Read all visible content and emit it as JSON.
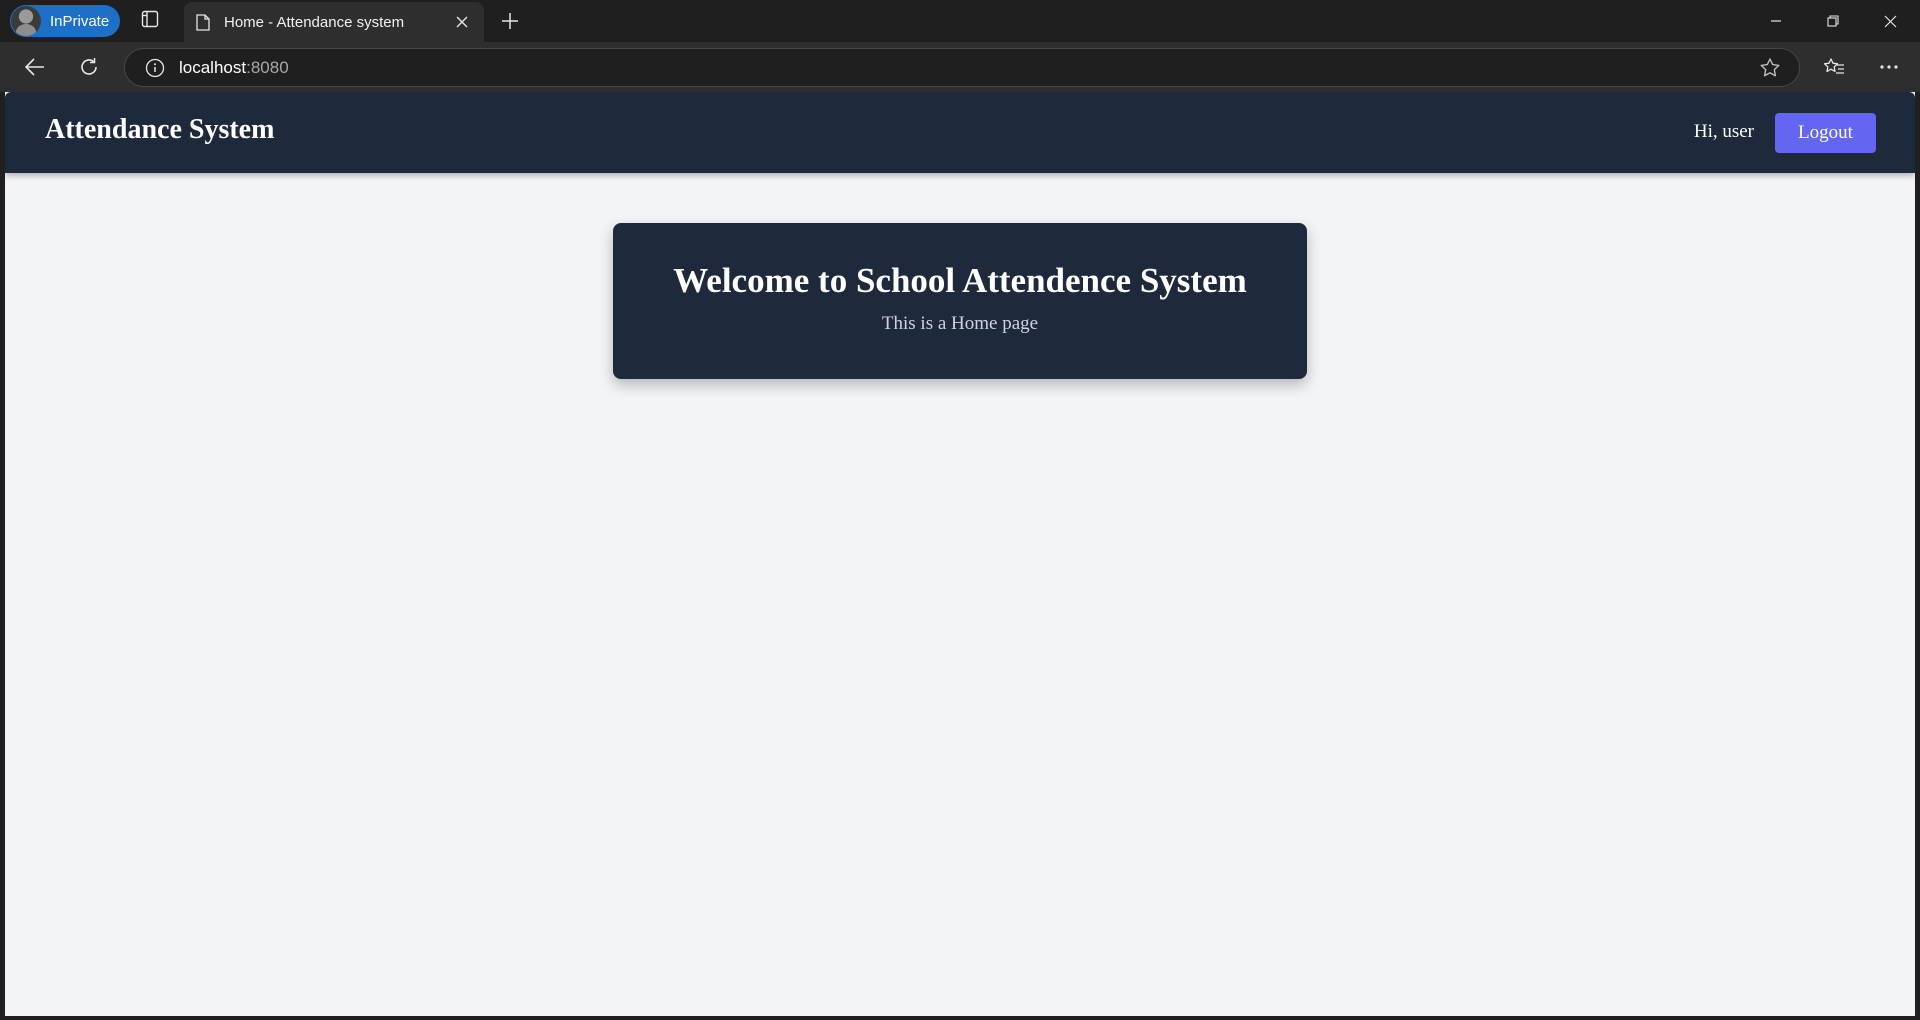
{
  "browser": {
    "inprivate_label": "InPrivate",
    "tab_title": "Home - Attendance system",
    "url_host": "localhost",
    "url_port": ":8080"
  },
  "page": {
    "brand": "Attendance System",
    "greeting": "Hi, user",
    "logout_label": "Logout",
    "welcome_title": "Welcome to School Attendence System",
    "welcome_subtitle": "This is a Home page"
  },
  "colors": {
    "navbar_bg": "#1e293b",
    "accent": "#6366f1",
    "page_bg": "#f3f4f6"
  }
}
